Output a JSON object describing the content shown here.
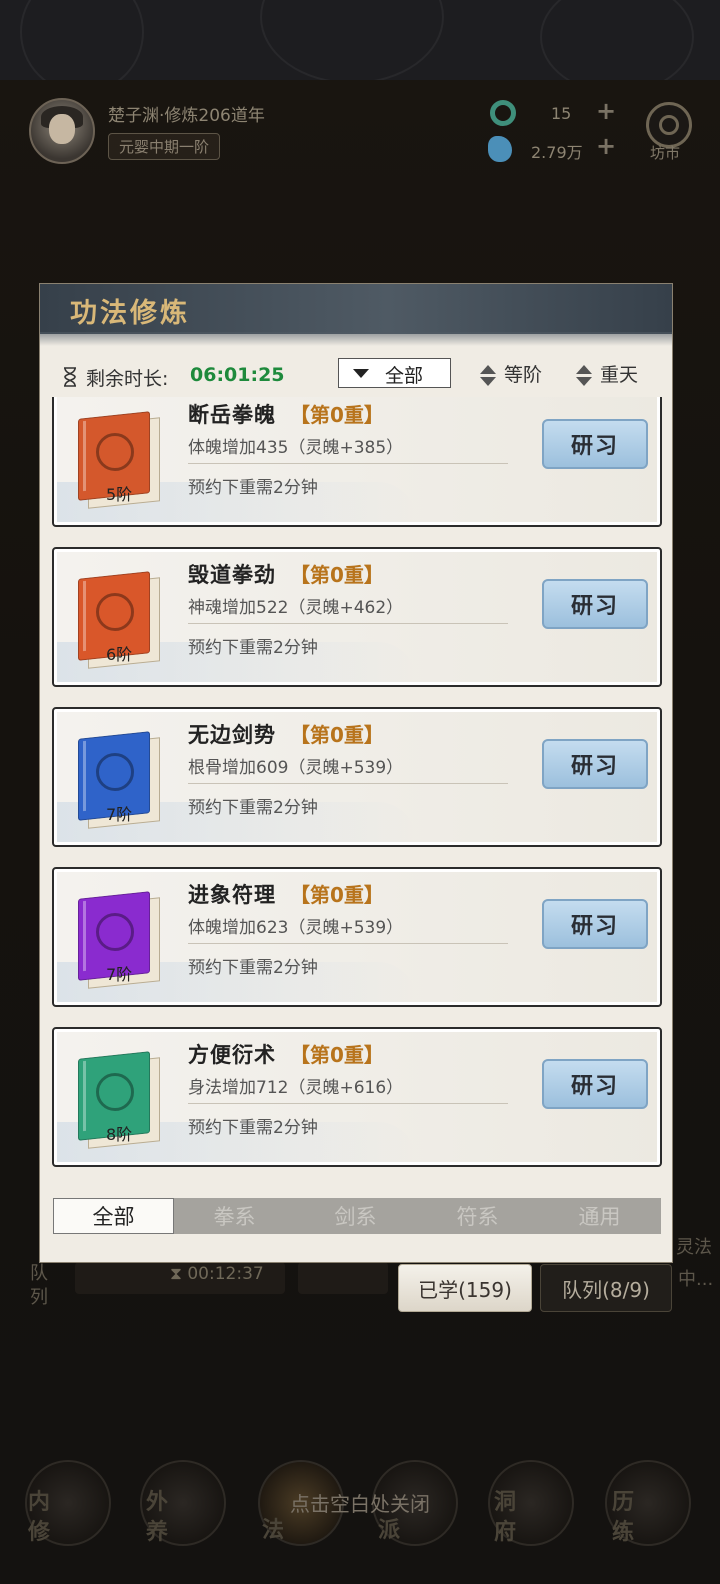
{
  "header": {
    "player_name": "楚子渊·修炼206道年",
    "realm": "元婴中期一阶",
    "resources": [
      {
        "icon": "jade-ring-icon",
        "value": "15",
        "color": "#3f8f7b"
      },
      {
        "icon": "spirit-stone-icon",
        "value": "2.79万",
        "color": "#4b8fb8"
      }
    ],
    "market_label": "坊市"
  },
  "panel": {
    "title": "功法修炼",
    "timer_label": "剩余时长:",
    "timer_value": "06:01:25",
    "filter_value": "全部",
    "sort_options": [
      "等阶",
      "重天"
    ],
    "cards": [
      {
        "name": "断岳拳魄",
        "level": "【第0重】",
        "bonus": "体魄增加435（灵魄+385）",
        "time": "预约下重需2分钟",
        "tier": "5阶",
        "color": "#d4582c",
        "icon": "fist-icon",
        "button": "研习"
      },
      {
        "name": "毁道拳劲",
        "level": "【第0重】",
        "bonus": "神魂增加522（灵魄+462）",
        "time": "预约下重需2分钟",
        "tier": "6阶",
        "color": "#d9572a",
        "icon": "fist-icon",
        "button": "研习"
      },
      {
        "name": "无边剑势",
        "level": "【第0重】",
        "bonus": "根骨增加609（灵魄+539）",
        "time": "预约下重需2分钟",
        "tier": "7阶",
        "color": "#2f63c9",
        "icon": "sword-icon",
        "button": "研习"
      },
      {
        "name": "进象符理",
        "level": "【第0重】",
        "bonus": "体魄增加623（灵魄+539）",
        "time": "预约下重需2分钟",
        "tier": "7阶",
        "color": "#8a2bcf",
        "icon": "talisman-icon",
        "button": "研习"
      },
      {
        "name": "方便衍术",
        "level": "【第0重】",
        "bonus": "身法增加712（灵魄+616）",
        "time": "预约下重需2分钟",
        "tier": "8阶",
        "color": "#2fa27a",
        "icon": "swirl-icon",
        "button": "研习"
      }
    ],
    "tabs": [
      "全部",
      "拳系",
      "剑系",
      "符系",
      "通用"
    ]
  },
  "behind": {
    "queue_time": "00:12:37",
    "left_side": "队列",
    "right_side_top": "灵法",
    "right_side_bottom": "中..."
  },
  "learned_button": "已学(159)",
  "queue_button": "队列(8/9)",
  "close_hint": "点击空白处关闭",
  "bottom_nav": [
    "内修",
    "外养",
    "法",
    "派",
    "洞府",
    "历练"
  ]
}
